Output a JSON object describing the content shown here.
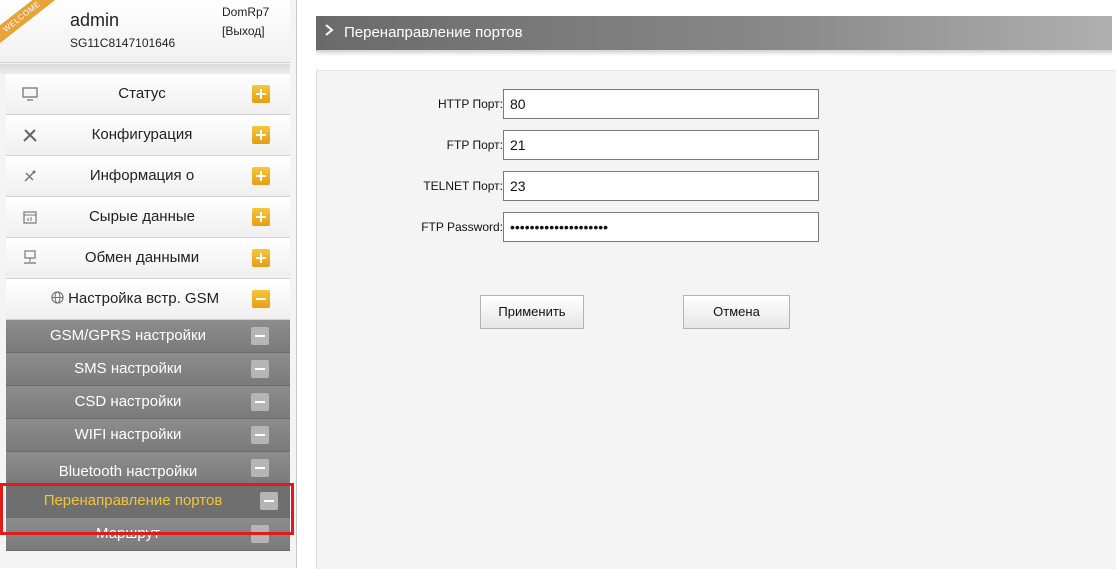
{
  "user": {
    "ribbon": "WELCOME",
    "name": "admin",
    "serial": "SG11C8147101646",
    "device": "DomRp7",
    "logout": "[Выход]"
  },
  "menu": [
    {
      "label": "Статус",
      "icon": "monitor-icon",
      "state": "collapsed"
    },
    {
      "label": "Конфигурация",
      "icon": "tools-icon",
      "state": "collapsed"
    },
    {
      "label": "Информация о",
      "icon": "satellite-icon",
      "state": "collapsed"
    },
    {
      "label": "Сырые данные",
      "icon": "calendar-icon",
      "state": "collapsed"
    },
    {
      "label": "Обмен данными",
      "icon": "network-icon",
      "state": "collapsed"
    },
    {
      "label": "Настройка встр. GSM",
      "icon": "globe-icon",
      "state": "expanded"
    }
  ],
  "submenu": [
    {
      "label": "GSM/GPRS настройки"
    },
    {
      "label": "SMS настройки"
    },
    {
      "label": "CSD настройки"
    },
    {
      "label": "WIFI настройки"
    },
    {
      "label": "Bluetooth настройки"
    },
    {
      "label": "Перенаправление портов",
      "active": true
    },
    {
      "label": "Маршрут"
    }
  ],
  "page": {
    "title": "Перенаправление портов",
    "fields": [
      {
        "label": "HTTP Порт:",
        "value": "80"
      },
      {
        "label": "FTP Порт:",
        "value": "21"
      },
      {
        "label": "TELNET Порт:",
        "value": "23"
      },
      {
        "label": "FTP Password:",
        "value": "••••••••••••••••••••"
      }
    ],
    "apply_label": "Применить",
    "cancel_label": "Отмена"
  },
  "colors": {
    "accent_orange": "#e79d12",
    "active_text": "#f0c53a",
    "highlight_box": "#e21a1a",
    "submenu_bg": "#8d8d8d"
  }
}
